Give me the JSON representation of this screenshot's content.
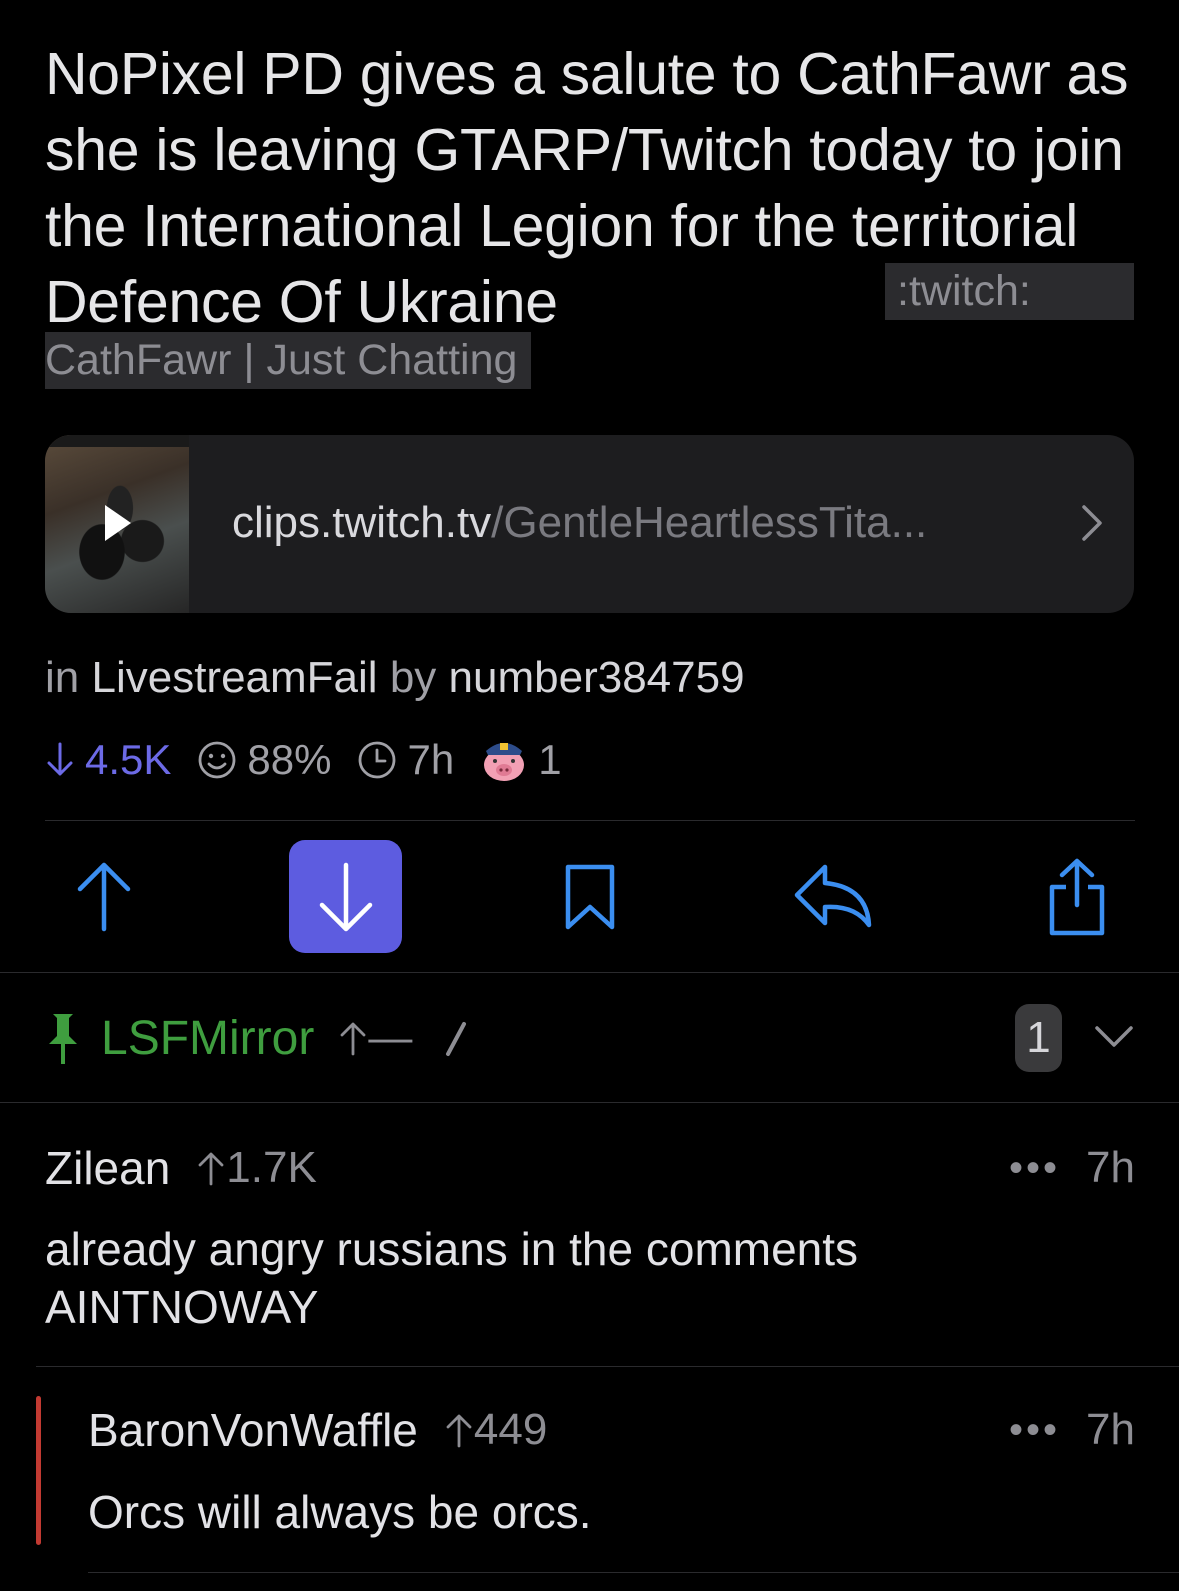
{
  "post": {
    "title": "NoPixel PD gives a salute to CathFawr as she is leaving GTARP/Twitch today to join the International Legion for the territorial Defence Of Ukraine",
    "flair_part1": ":twitch:",
    "flair_part2": "CathFawr | Just Chatting",
    "link_domain": "clips.twitch.tv",
    "link_path": "/GentleHeartlessTita...",
    "in_label": "in",
    "subreddit": "LivestreamFail",
    "by_label": "by",
    "author": "number384759",
    "score": "4.5K",
    "upvote_ratio": "88%",
    "age": "7h",
    "awards_count": "1"
  },
  "actions": {
    "upvote_icon": "arrow-up-icon",
    "downvote_icon": "arrow-down-icon",
    "save_icon": "bookmark-icon",
    "reply_icon": "reply-icon",
    "share_icon": "share-icon"
  },
  "pinned": {
    "author": "LSFMirror",
    "score": "—",
    "count": "1"
  },
  "comments": [
    {
      "author": "Zilean",
      "score": "1.7K",
      "more": "•••",
      "age": "7h",
      "body": "already angry russians in the comments AINTNOWAY"
    },
    {
      "author": "BaronVonWaffle",
      "score": "449",
      "more": "•••",
      "age": "7h",
      "body": "Orcs will always be orcs."
    }
  ],
  "colors": {
    "accent": "#5d5ce0",
    "blue_icon": "#3b8ef0",
    "green": "#3f9e3f",
    "depth_bar": "#c23a32"
  }
}
